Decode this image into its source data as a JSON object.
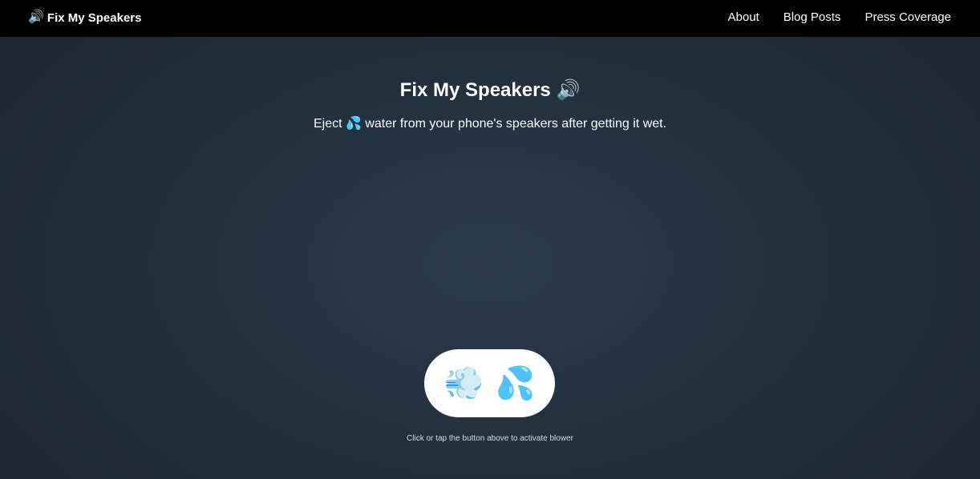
{
  "nav": {
    "brand_icon": "🔊",
    "brand_label": "Fix My Speakers",
    "links": [
      {
        "label": "About"
      },
      {
        "label": "Blog Posts"
      },
      {
        "label": "Press Coverage"
      }
    ]
  },
  "hero": {
    "title": "Fix My Speakers 🔊",
    "subtitle": "Eject 💦 water from your phone's speakers after getting it wet."
  },
  "blower": {
    "icon_wind": "💨",
    "icon_water": "💦",
    "hint": "Click or tap the button above to activate blower"
  },
  "colors": {
    "navbar": "#000000",
    "background": "#22303d",
    "button": "#ffffff"
  }
}
